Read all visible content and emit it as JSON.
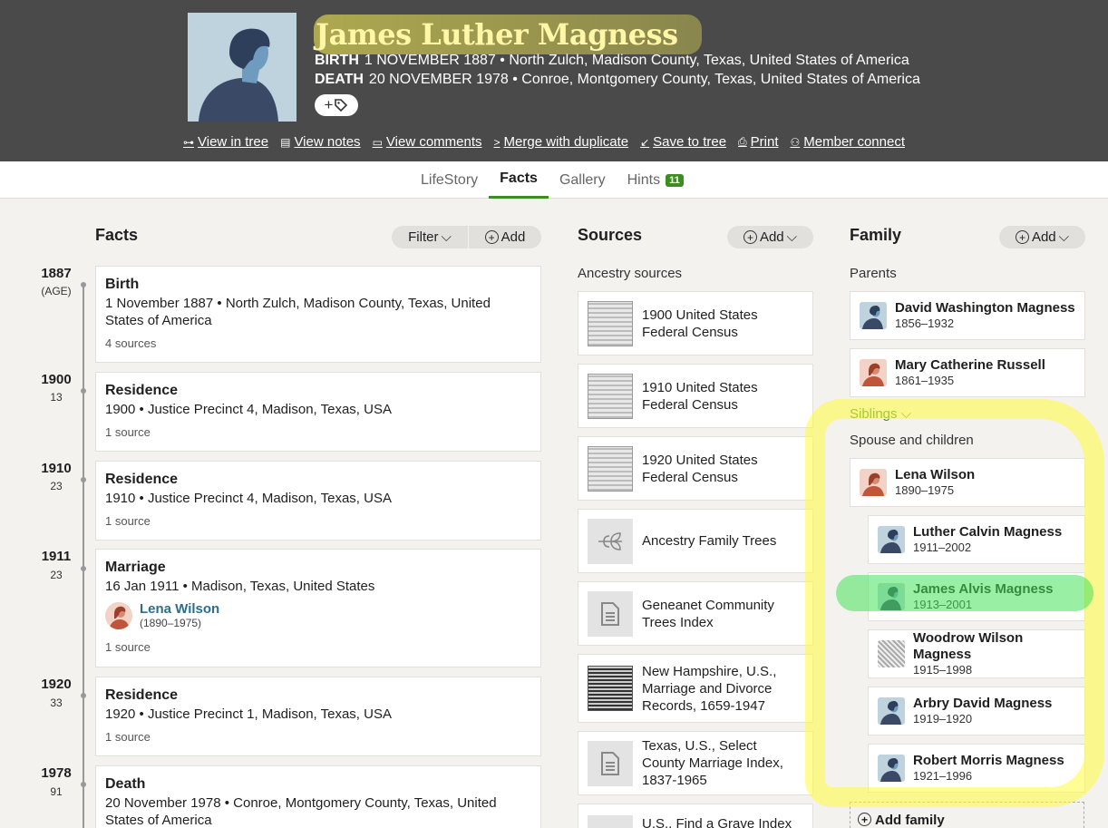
{
  "person": {
    "name": "James Luther Magness",
    "birth_label": "BIRTH",
    "birth": "1 NOVEMBER 1887 • North Zulch, Madison County, Texas, United States of America",
    "death_label": "DEATH",
    "death": "20 NOVEMBER 1978 • Conroe, Montgomery County, Texas, United States of America"
  },
  "actions": [
    {
      "label": "View in tree",
      "icon": "tree-icon"
    },
    {
      "label": "View notes",
      "icon": "notes-icon"
    },
    {
      "label": "View comments",
      "icon": "comments-icon"
    },
    {
      "label": "Merge with duplicate",
      "icon": "merge-icon"
    },
    {
      "label": "Save to tree",
      "icon": "save-icon"
    },
    {
      "label": "Print",
      "icon": "print-icon"
    },
    {
      "label": "Member connect",
      "icon": "members-icon"
    }
  ],
  "tabs": [
    {
      "label": "LifeStory",
      "active": false
    },
    {
      "label": "Facts",
      "active": true
    },
    {
      "label": "Gallery",
      "active": false
    },
    {
      "label": "Hints",
      "active": false,
      "badge": "11"
    }
  ],
  "facts": {
    "title": "Facts",
    "filter_label": "Filter",
    "add_label": "Add",
    "items": [
      {
        "year": "1887",
        "age": "(AGE)",
        "type": "Birth",
        "detail": "1 November 1887 • North Zulch, Madison County, Texas, United States of America",
        "sources": "4 sources"
      },
      {
        "year": "1900",
        "age": "13",
        "type": "Residence",
        "detail": "1900 • Justice Precinct 4, Madison, Texas, USA",
        "sources": "1 source"
      },
      {
        "year": "1910",
        "age": "23",
        "type": "Residence",
        "detail": "1910 • Justice Precinct 4, Madison, Texas, USA",
        "sources": "1 source"
      },
      {
        "year": "1911",
        "age": "23",
        "type": "Marriage",
        "detail": "16 Jan 1911 • Madison, Texas, United States",
        "spouse": "Lena Wilson",
        "spouse_dates": "(1890–1975)",
        "sources": "1 source"
      },
      {
        "year": "1920",
        "age": "33",
        "type": "Residence",
        "detail": "1920 • Justice Precinct 1, Madison, Texas, USA",
        "sources": "1 source"
      },
      {
        "year": "1978",
        "age": "91",
        "type": "Death",
        "detail": "20 November 1978 • Conroe, Montgomery County, Texas, United States of America",
        "sources": ""
      }
    ]
  },
  "sources": {
    "title": "Sources",
    "add_label": "Add",
    "subtitle": "Ancestry sources",
    "items": [
      {
        "title": "1900 United States Federal Census",
        "thumb": "census"
      },
      {
        "title": "1910 United States Federal Census",
        "thumb": "census"
      },
      {
        "title": "1920 United States Federal Census",
        "thumb": "census"
      },
      {
        "title": "Ancestry Family Trees",
        "thumb": "tree-leaf-icon"
      },
      {
        "title": "Geneanet Community Trees Index",
        "thumb": "document-icon"
      },
      {
        "title": "New Hampshire, U.S., Marriage and Divorce Records, 1659-1947",
        "thumb": "record"
      },
      {
        "title": "Texas, U.S., Select County Marriage Index, 1837-1965",
        "thumb": "document-icon"
      },
      {
        "title": "U.S., Find a Grave Index",
        "thumb": "document-icon"
      }
    ]
  },
  "family": {
    "title": "Family",
    "add_label": "Add",
    "parents_label": "Parents",
    "parents": [
      {
        "name": "David Washington Magness",
        "years": "1856–1932",
        "gender": "m"
      },
      {
        "name": "Mary Catherine Russell",
        "years": "1861–1935",
        "gender": "f"
      }
    ],
    "siblings_label": "Siblings",
    "spouse_label": "Spouse and children",
    "spouse": {
      "name": "Lena Wilson",
      "years": "1890–1975",
      "gender": "f"
    },
    "children": [
      {
        "name": "Luther Calvin Magness",
        "years": "1911–2002",
        "gender": "m"
      },
      {
        "name": "James Alvis Magness",
        "years": "1913–2001",
        "gender": "m"
      },
      {
        "name": "Woodrow Wilson Magness",
        "years": "1915–1998",
        "gender": "photo"
      },
      {
        "name": "Arbry David Magness",
        "years": "1919–1920",
        "gender": "m"
      },
      {
        "name": "Robert Morris Magness",
        "years": "1921–1996",
        "gender": "m"
      }
    ],
    "add_family_label": "Add family"
  },
  "colors": {
    "header_bg": "#4a4a4a",
    "accent_green": "#3f8c22",
    "link_blue": "#2a6f8c",
    "highlight_yellow": "#fffc3c",
    "highlight_green": "#46e15a"
  }
}
